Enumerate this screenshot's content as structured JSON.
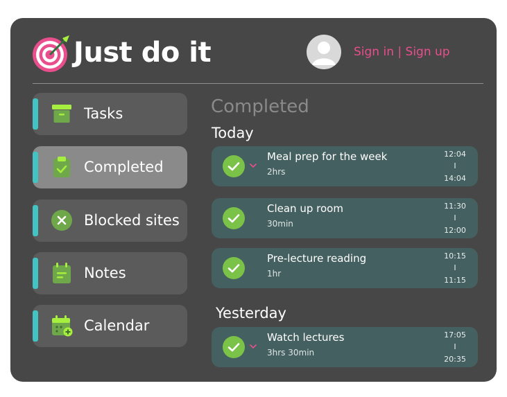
{
  "app": {
    "title": "Just do it",
    "logo_icon": "target-dart-icon"
  },
  "header": {
    "avatar_icon": "user-avatar-icon",
    "sign_in": "Sign in",
    "separator": "|",
    "sign_up": "Sign up"
  },
  "sidebar": {
    "items": [
      {
        "label": "Tasks",
        "icon": "archive-box-icon",
        "active": false
      },
      {
        "label": "Completed",
        "icon": "clipboard-check-icon",
        "active": true
      },
      {
        "label": "Blocked sites",
        "icon": "close-circle-icon",
        "active": false
      },
      {
        "label": "Notes",
        "icon": "notepad-icon",
        "active": false
      },
      {
        "label": "Calendar",
        "icon": "calendar-add-icon",
        "active": false
      }
    ]
  },
  "main": {
    "title": "Completed",
    "groups": [
      {
        "label": "Today",
        "tasks": [
          {
            "title": "Meal prep for the week",
            "duration": "2hrs",
            "start": "12:04",
            "sep": "I",
            "end": "14:04",
            "expandable": true
          },
          {
            "title": "Clean up room",
            "duration": "30min",
            "start": "11:30",
            "sep": "I",
            "end": "12:00",
            "expandable": false
          },
          {
            "title": "Pre-lecture reading",
            "duration": "1hr",
            "start": "10:15",
            "sep": "I",
            "end": "11:15",
            "expandable": false
          }
        ]
      },
      {
        "label": "Yesterday",
        "tasks": [
          {
            "title": "Watch lectures",
            "duration": "3hrs 30min",
            "start": "17:05",
            "sep": "I",
            "end": "20:35",
            "expandable": true
          }
        ]
      }
    ]
  },
  "colors": {
    "panel": "#474747",
    "accent_pink": "#e84f8c",
    "accent_teal": "#43c3c3",
    "check_green": "#7bc248",
    "icon_green": "#a6ef3f",
    "task_card": "#456060"
  }
}
